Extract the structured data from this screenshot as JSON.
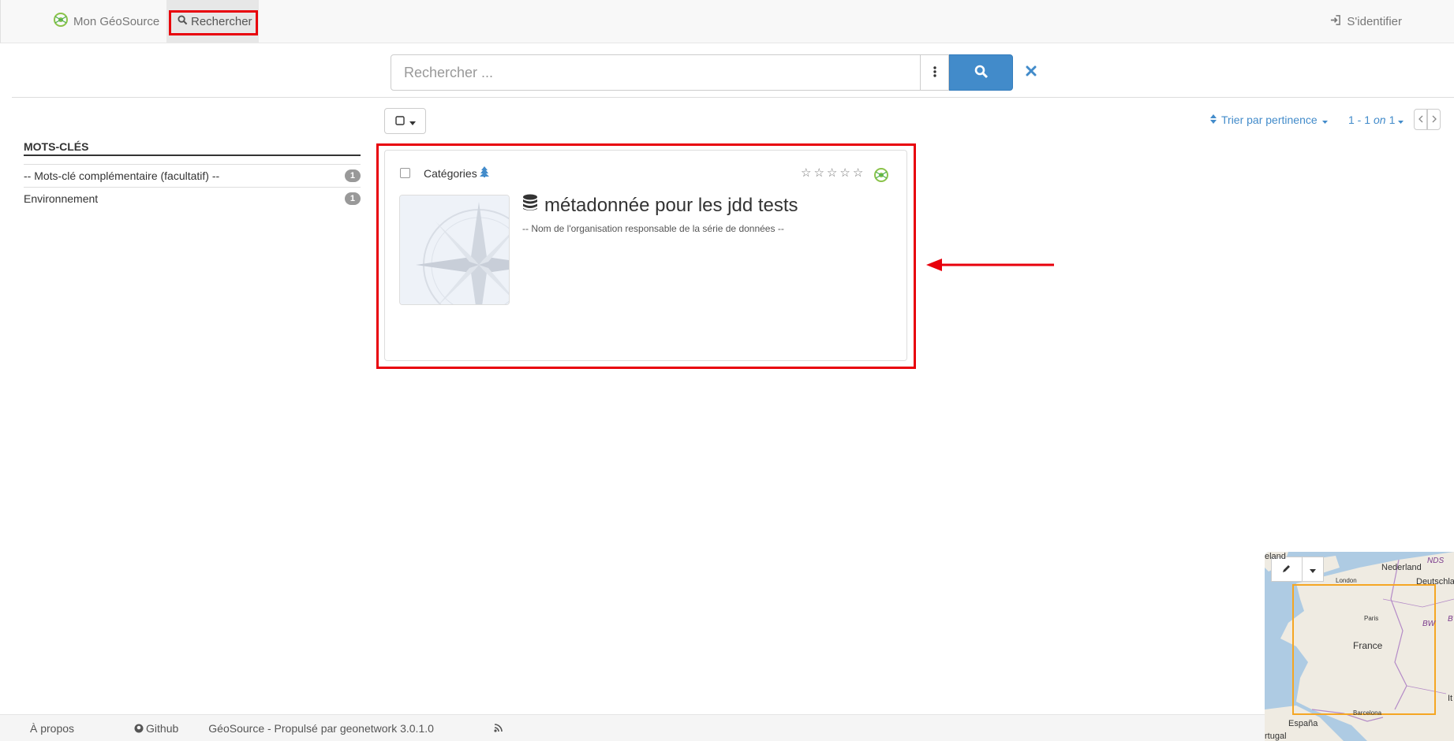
{
  "navbar": {
    "home_label": "Mon GéoSource",
    "search_label": "Rechercher",
    "login_label": "S'identifier"
  },
  "search": {
    "placeholder": "Rechercher ...",
    "value": ""
  },
  "toolbar": {
    "sort_label": "Trier par pertinence",
    "pager_from_to": "1 - 1",
    "pager_on": "on",
    "pager_total": "1"
  },
  "facets": {
    "title": "MOTS-CLÉS",
    "items": [
      {
        "label": "-- Mots-clé complémentaire (facultatif) --",
        "count": "1"
      },
      {
        "label": "Environnement",
        "count": "1"
      }
    ]
  },
  "result": {
    "categories_label": "Catégories",
    "title": "métadonnée pour les jdd tests",
    "organisation": "-- Nom de l'organisation responsable de la série de données --",
    "rating": 0,
    "rating_max": 5
  },
  "map": {
    "labels": {
      "nederland": "Nederland",
      "deutschland": "Deutschla",
      "london": "London",
      "paris": "Paris",
      "france": "France",
      "espana": "España",
      "portugal": "rtugal",
      "barcelona": "Barcelona",
      "nds": "NDS",
      "by": "BY",
      "bw": "BW",
      "ireland": "eland",
      "it": "It"
    }
  },
  "footer": {
    "about": "À propos",
    "github": "Github",
    "powered": "GéoSource - Propulsé par geonetwork 3.0.1.0"
  },
  "colors": {
    "primary": "#428bca",
    "annotation": "#e8000b",
    "bbox": "#f5a623"
  }
}
